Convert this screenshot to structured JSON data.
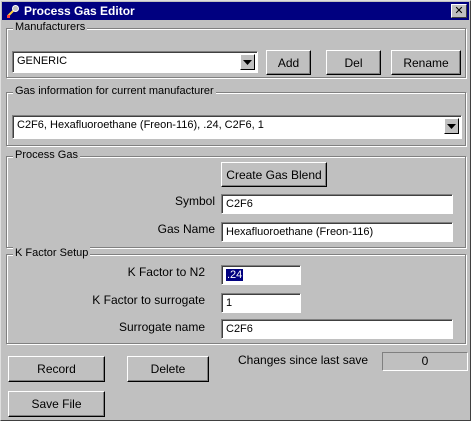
{
  "window": {
    "title": "Process Gas Editor",
    "close_glyph": "✕",
    "icon": "gas-valve-icon",
    "colors": {
      "titlebar": "#000080",
      "face": "#c0c0c0",
      "selection": "#000080"
    }
  },
  "manufacturers": {
    "label": "Manufacturers",
    "selected": "GENERIC",
    "add_label": "Add",
    "del_label": "Del",
    "rename_label": "Rename"
  },
  "gas_info": {
    "label": "Gas information for current manufacturer",
    "selected": "C2F6, Hexafluoroethane (Freon-116),  .24, C2F6,  1"
  },
  "process_gas": {
    "label": "Process Gas",
    "create_blend_label": "Create Gas Blend",
    "symbol_label": "Symbol",
    "symbol_value": "C2F6",
    "gas_name_label": "Gas Name",
    "gas_name_value": "Hexafluoroethane (Freon-116)"
  },
  "k_factor": {
    "label": "K Factor Setup",
    "to_n2_label": "K Factor to N2",
    "to_n2_value": ".24",
    "surrogate_label": "K Factor to surrogate",
    "surrogate_value": "1",
    "surrogate_name_label": "Surrogate name",
    "surrogate_name_value": "C2F6"
  },
  "footer": {
    "record_label": "Record",
    "delete_label": "Delete",
    "changes_label": "Changes since last save",
    "changes_value": "0",
    "save_file_label": "Save File"
  }
}
